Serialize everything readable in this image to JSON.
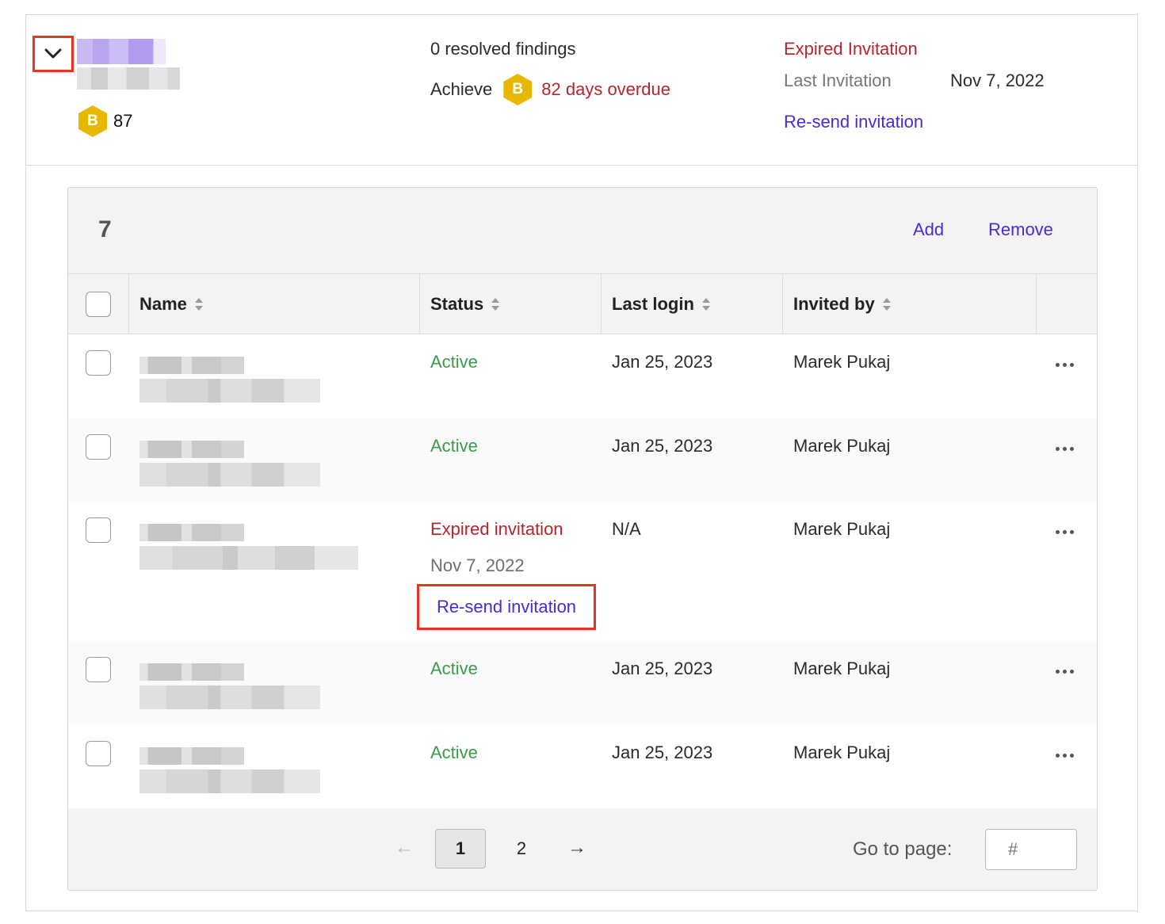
{
  "header": {
    "score_badge": "B",
    "score_value": "87",
    "findings": "0 resolved findings",
    "achieve_label": "Achieve",
    "achieve_badge": "B",
    "overdue": "82 days overdue",
    "invitation_status": "Expired Invitation",
    "last_invitation_label": "Last Invitation",
    "last_invitation_date": "Nov 7, 2022",
    "resend_label": "Re-send invitation"
  },
  "panel": {
    "count": "7",
    "add_label": "Add",
    "remove_label": "Remove"
  },
  "table": {
    "columns": [
      "Name",
      "Status",
      "Last login",
      "Invited by"
    ],
    "rows": [
      {
        "status": "Active",
        "status_type": "active",
        "last_login": "Jan 25, 2023",
        "invited_by": "Marek Pukaj"
      },
      {
        "status": "Active",
        "status_type": "active",
        "last_login": "Jan 25, 2023",
        "invited_by": "Marek Pukaj"
      },
      {
        "status": "Expired invitation",
        "status_type": "expired",
        "status_date": "Nov 7, 2022",
        "resend_label": "Re-send invitation",
        "last_login": "N/A",
        "invited_by": "Marek Pukaj"
      },
      {
        "status": "Active",
        "status_type": "active",
        "last_login": "Jan 25, 2023",
        "invited_by": "Marek Pukaj"
      },
      {
        "status": "Active",
        "status_type": "active",
        "last_login": "Jan 25, 2023",
        "invited_by": "Marek Pukaj"
      }
    ]
  },
  "pagination": {
    "prev": "←",
    "pages": [
      "1",
      "2"
    ],
    "next": "→",
    "goto_label": "Go to page:",
    "goto_placeholder": "#"
  },
  "colors": {
    "accent": "#4a29d8",
    "active": "#3c9a4a",
    "expired": "#b3262d",
    "badge": "#e7b800",
    "highlight": "#e8341c"
  },
  "icons": {
    "toggle": "chevron-down-icon",
    "more": "more-horizontal-icon"
  }
}
